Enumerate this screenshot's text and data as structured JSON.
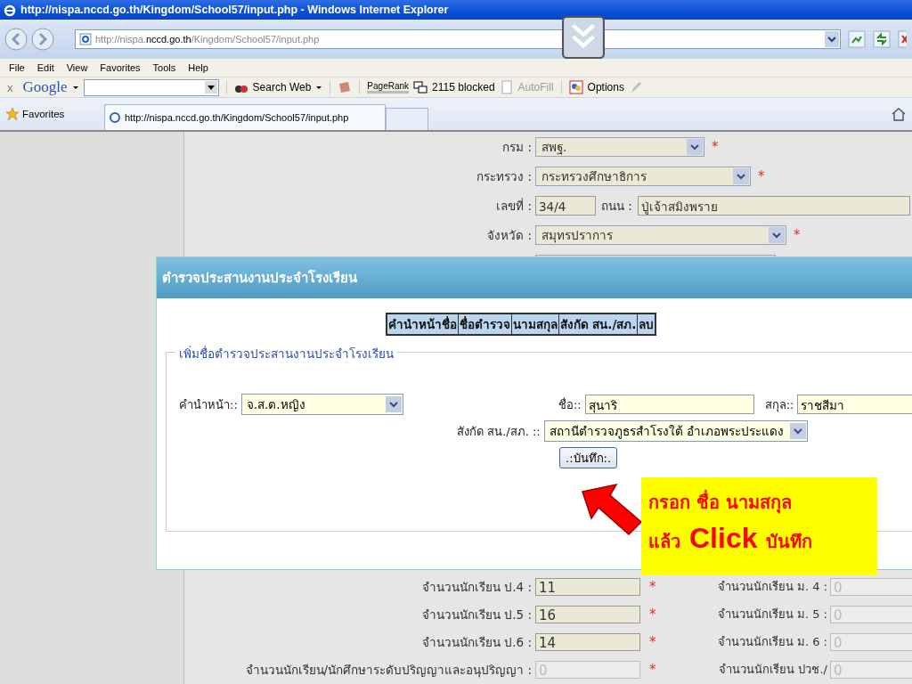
{
  "window": {
    "title": "http://nispa.nccd.go.th/Kingdom/School57/input.php - Windows Internet Explorer"
  },
  "address": {
    "prefix": "http://nispa.",
    "host": "nccd.go.th",
    "path": "/Kingdom/School57/input.php"
  },
  "menu": [
    "File",
    "Edit",
    "View",
    "Favorites",
    "Tools",
    "Help"
  ],
  "google_toolbar": {
    "close": "x",
    "logo": "Google",
    "search_web": "Search Web",
    "pagerank": "PageRank",
    "blocked": "2115 blocked",
    "autofill": "AutoFill",
    "options": "Options"
  },
  "favorites_bar": {
    "label": "Favorites",
    "tab": "http://nispa.nccd.go.th/Kingdom/School57/input.php"
  },
  "form_top": [
    {
      "kind": "select",
      "label": "กรม :",
      "value": "สพฐ.",
      "required_mark": "*"
    },
    {
      "kind": "select",
      "label": "กระทรวง :",
      "value": "กระทรวงศึกษาธิการ",
      "required_mark": "*"
    },
    {
      "kind": "pair",
      "label": "เลขที่ :",
      "value": "34/4",
      "label2": "ถนน :",
      "value2": "ปู่เจ้าสมิงพราย"
    },
    {
      "kind": "select",
      "label": "จังหวัด :",
      "value": "สมุทรปราการ",
      "required_mark": "*"
    }
  ],
  "dialog": {
    "title": "ตำรวจประสานงานประจำโรงเรียน",
    "table_columns": [
      "คำนำหน้าชื่อ",
      "ชื่อตำรวจ",
      "นามสกุล",
      "สังกัด สน./สภ.",
      "ลบ"
    ],
    "fieldset_legend": "เพิ่มชื่อตำรวจประสานงานประจำโรงเรียน",
    "prefix": {
      "label": "คำนำหน้า::",
      "value": "จ.ส.ต.หญิง"
    },
    "first_name": {
      "label": "ชื่อ::",
      "value": "สุนาริ"
    },
    "last_name": {
      "label": "สกุล::",
      "value": "ราชสีมา"
    },
    "station": {
      "label": "สังกัด สน./สภ. ::",
      "value": "สถานีตำรวจภูธรสำโรงใต้ อำเภอพระประแดง"
    },
    "save_button": ".:บันทึก:."
  },
  "callout": {
    "line1": "กรอก ชื่อ นามสกุล",
    "line2_a": "แล้ว",
    "line2_b": "Click",
    "line2_c": "บันทึก"
  },
  "form_bottom": [
    {
      "label": "จำนวนนักเรียน ป.4 :",
      "value": "11",
      "disabled": false,
      "required_mark": "*",
      "label2": "จำนวนนักเรียน ม. 4 :",
      "value2": "0"
    },
    {
      "label": "จำนวนนักเรียน ป.5 :",
      "value": "16",
      "disabled": false,
      "required_mark": "*",
      "label2": "จำนวนนักเรียน ม. 5 :",
      "value2": "0"
    },
    {
      "label": "จำนวนนักเรียน ป.6 :",
      "value": "14",
      "disabled": false,
      "required_mark": "*",
      "label2": "จำนวนนักเรียน ม. 6 :",
      "value2": "0"
    },
    {
      "label": "จำนวนนักเรียน/นักศึกษาระดับปริญญาและอนุปริญญา :",
      "value": "0",
      "disabled": true,
      "required_mark": "*",
      "label2": "จำนวนนักเรียน ปวช./",
      "value2": "0"
    }
  ]
}
